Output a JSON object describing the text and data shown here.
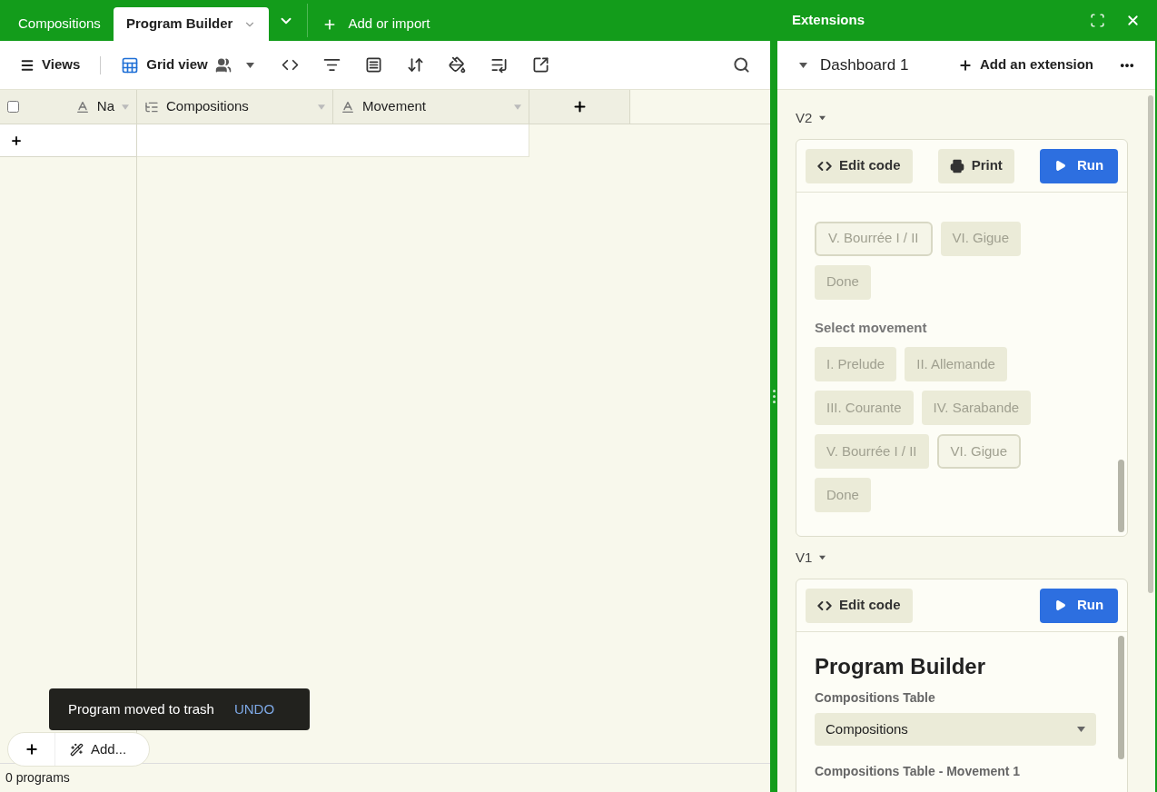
{
  "tabs": [
    {
      "label": "Compositions",
      "selected": false
    },
    {
      "label": "Program Builder",
      "selected": true
    }
  ],
  "add_import": "Add or import",
  "toolbar": {
    "views": "Views",
    "view_name": "Grid view"
  },
  "grid": {
    "select_all_checked": false,
    "columns": [
      {
        "label": "Na",
        "kind": "text"
      },
      {
        "label": "Compositions",
        "kind": "link"
      },
      {
        "label": "Movement",
        "kind": "text"
      }
    ]
  },
  "toast": {
    "message": "Program moved to trash",
    "action": "UNDO"
  },
  "add_menu": "Add...",
  "status": "0 programs",
  "extensions": {
    "title": "Extensions",
    "dashboard": "Dashboard 1",
    "add_extension": "Add an extension",
    "blocks": [
      {
        "name": "V2",
        "toolbar": [
          {
            "kind": "edit",
            "label": "Edit code"
          },
          {
            "kind": "print",
            "label": "Print"
          },
          {
            "kind": "run",
            "label": "Run"
          }
        ],
        "content": [
          {
            "kind": "choices",
            "disabled": true,
            "options": [
              {
                "label": "V. Bourrée I / II",
                "selected": true
              },
              {
                "label": "VI. Gigue",
                "selected": false
              },
              {
                "label": "Done",
                "selected": false
              }
            ]
          },
          {
            "kind": "choices",
            "disabled": true,
            "heading": "Select movement",
            "options": [
              {
                "label": "I. Prelude",
                "selected": false
              },
              {
                "label": "II. Allemande",
                "selected": false
              },
              {
                "label": "III. Courante",
                "selected": false
              },
              {
                "label": "IV. Sarabande",
                "selected": false
              },
              {
                "label": "V. Bourrée I / II",
                "selected": false
              },
              {
                "label": "VI. Gigue",
                "selected": true
              },
              {
                "label": "Done",
                "selected": false
              }
            ]
          }
        ]
      },
      {
        "name": "V1",
        "toolbar": [
          {
            "kind": "edit",
            "label": "Edit code"
          },
          {
            "kind": "run",
            "label": "Run"
          }
        ],
        "content": [
          {
            "kind": "title",
            "text": "Program Builder"
          },
          {
            "kind": "label",
            "text": "Compositions Table"
          },
          {
            "kind": "select",
            "value": "Compositions"
          },
          {
            "kind": "label",
            "text": "Compositions Table - Movement 1"
          }
        ]
      }
    ]
  }
}
